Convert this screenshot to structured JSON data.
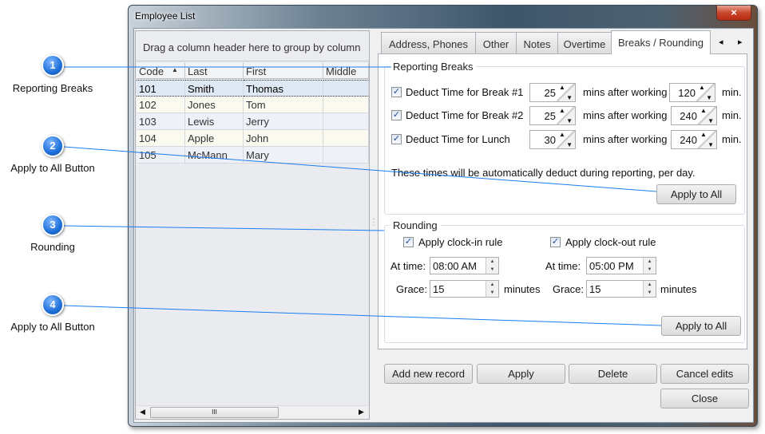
{
  "window": {
    "title": "Employee List",
    "close_icon": "×"
  },
  "grid": {
    "group_hint": "Drag a column header here to group by column",
    "columns": [
      "Code",
      "Last",
      "First",
      "Middle"
    ],
    "sort_icon": "▲",
    "rows": [
      [
        "101",
        "Smith",
        "Thomas",
        ""
      ],
      [
        "102",
        "Jones",
        "Tom",
        ""
      ],
      [
        "103",
        "Lewis",
        "Jerry",
        ""
      ],
      [
        "104",
        "Apple",
        "John",
        ""
      ],
      [
        "105",
        "McMann",
        "Mary",
        ""
      ]
    ],
    "scroll_grip": "III"
  },
  "tabs": {
    "items": [
      "Address, Phones",
      "Other",
      "Notes",
      "Overtime",
      "Breaks / Rounding"
    ],
    "active": 4,
    "prev": "◂",
    "next": "▸"
  },
  "breaks": {
    "legend": "Reporting Breaks",
    "rows": [
      {
        "label": "Deduct Time for Break #1",
        "checked": true,
        "mins": "25",
        "after": "120"
      },
      {
        "label": "Deduct Time for Break #2",
        "checked": true,
        "mins": "25",
        "after": "240"
      },
      {
        "label": "Deduct Time for Lunch",
        "checked": true,
        "mins": "30",
        "after": "240"
      }
    ],
    "mins_after": "mins after working",
    "min_unit": "min.",
    "note": "These times will be automatically deduct during reporting, per day.",
    "apply_all": "Apply to All"
  },
  "rounding": {
    "legend": "Rounding",
    "clock_in": {
      "label": "Apply clock-in rule",
      "checked": true,
      "at_label": "At time:",
      "at": "08:00 AM",
      "grace_label": "Grace:",
      "grace": "15",
      "unit": "minutes"
    },
    "clock_out": {
      "label": "Apply clock-out rule",
      "checked": true,
      "at_label": "At time:",
      "at": "05:00 PM",
      "grace_label": "Grace:",
      "grace": "15",
      "unit": "minutes"
    },
    "apply_all": "Apply to All"
  },
  "buttons": {
    "add": "Add new record",
    "apply": "Apply",
    "delete": "Delete",
    "cancel": "Cancel edits",
    "close": "Close"
  },
  "callouts": [
    {
      "n": "1",
      "label": "Reporting Breaks"
    },
    {
      "n": "2",
      "label": "Apply to All Button"
    },
    {
      "n": "3",
      "label": "Rounding"
    },
    {
      "n": "4",
      "label": "Apply to All Button"
    }
  ],
  "colors": {
    "callout": "#1e6fd9",
    "line": "#1a7cf0",
    "title_bar": "#4f667a"
  }
}
